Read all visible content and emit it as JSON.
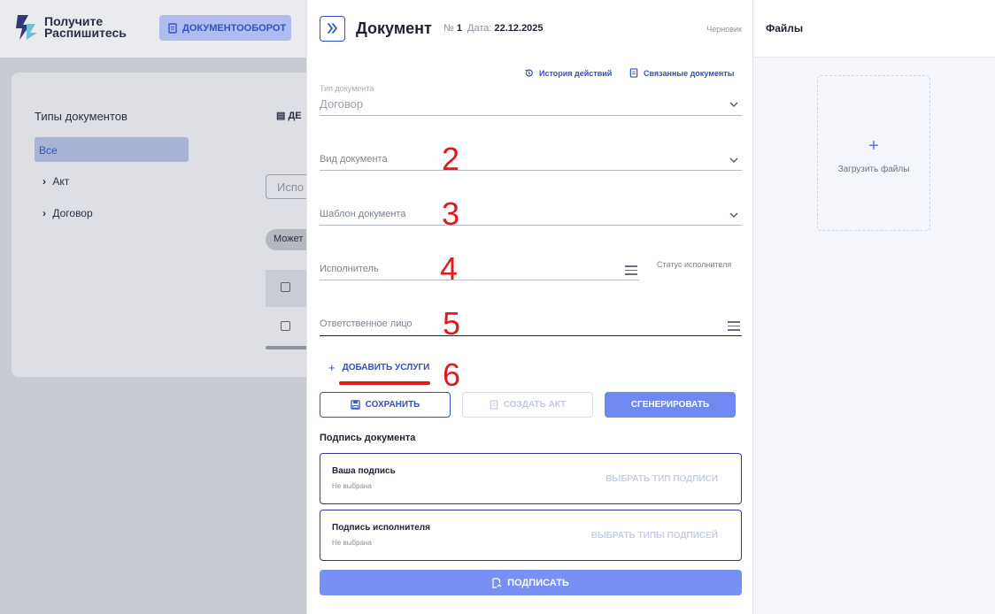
{
  "background": {
    "logo_line1": "Получите",
    "logo_line2": "Распишитесь",
    "nav_button": "ДОКУМЕНТООБОРОТ",
    "doc_types_title": "Типы документов",
    "doc_types_all": "Все",
    "doc_types_items": [
      "Акт",
      "Договор"
    ],
    "partial_tab": "ДЕ",
    "partial_search": "Испо",
    "partial_pill": "Может"
  },
  "header": {
    "title": "Документ",
    "number_label": "№",
    "number_value": "1",
    "date_label": "Дата:",
    "date_value": "22.12.2025",
    "status": "Черновик"
  },
  "links": {
    "history": "История действий",
    "related": "Связанные документы"
  },
  "form": {
    "doc_type_label": "Тип документа",
    "doc_type_value": "Договор",
    "doc_kind_placeholder": "Вид документа",
    "template_placeholder": "Шаблон документа",
    "executor_placeholder": "Исполнитель",
    "executor_status": "Статус исполнителя",
    "responsible_placeholder": "Ответственное лицо",
    "add_services": "ДОБАВИТЬ УСЛУГИ"
  },
  "annotations": [
    "2",
    "3",
    "4",
    "5",
    "6"
  ],
  "buttons": {
    "save": "СОХРАНИТЬ",
    "create_act": "СОЗДАТЬ АКТ",
    "generate": "СГЕНЕРИРОВАТЬ",
    "sign": "ПОДПИСАТЬ"
  },
  "signature": {
    "title": "Подпись документа",
    "cards": [
      {
        "name": "Ваша подпись",
        "state": "Не выбрана",
        "action": "ВЫБРАТЬ ТИП ПОДПИСИ"
      },
      {
        "name": "Подпись исполнителя",
        "state": "Не выбрана",
        "action": "ВЫБРАТЬ ТИПЫ ПОДПИСЕЙ"
      }
    ]
  },
  "files": {
    "title": "Файлы",
    "upload_label": "Загрузить файлы"
  },
  "colors": {
    "accent": "#3250c8",
    "primary_button": "#6f89f3",
    "annotation": "#e01a1a"
  }
}
